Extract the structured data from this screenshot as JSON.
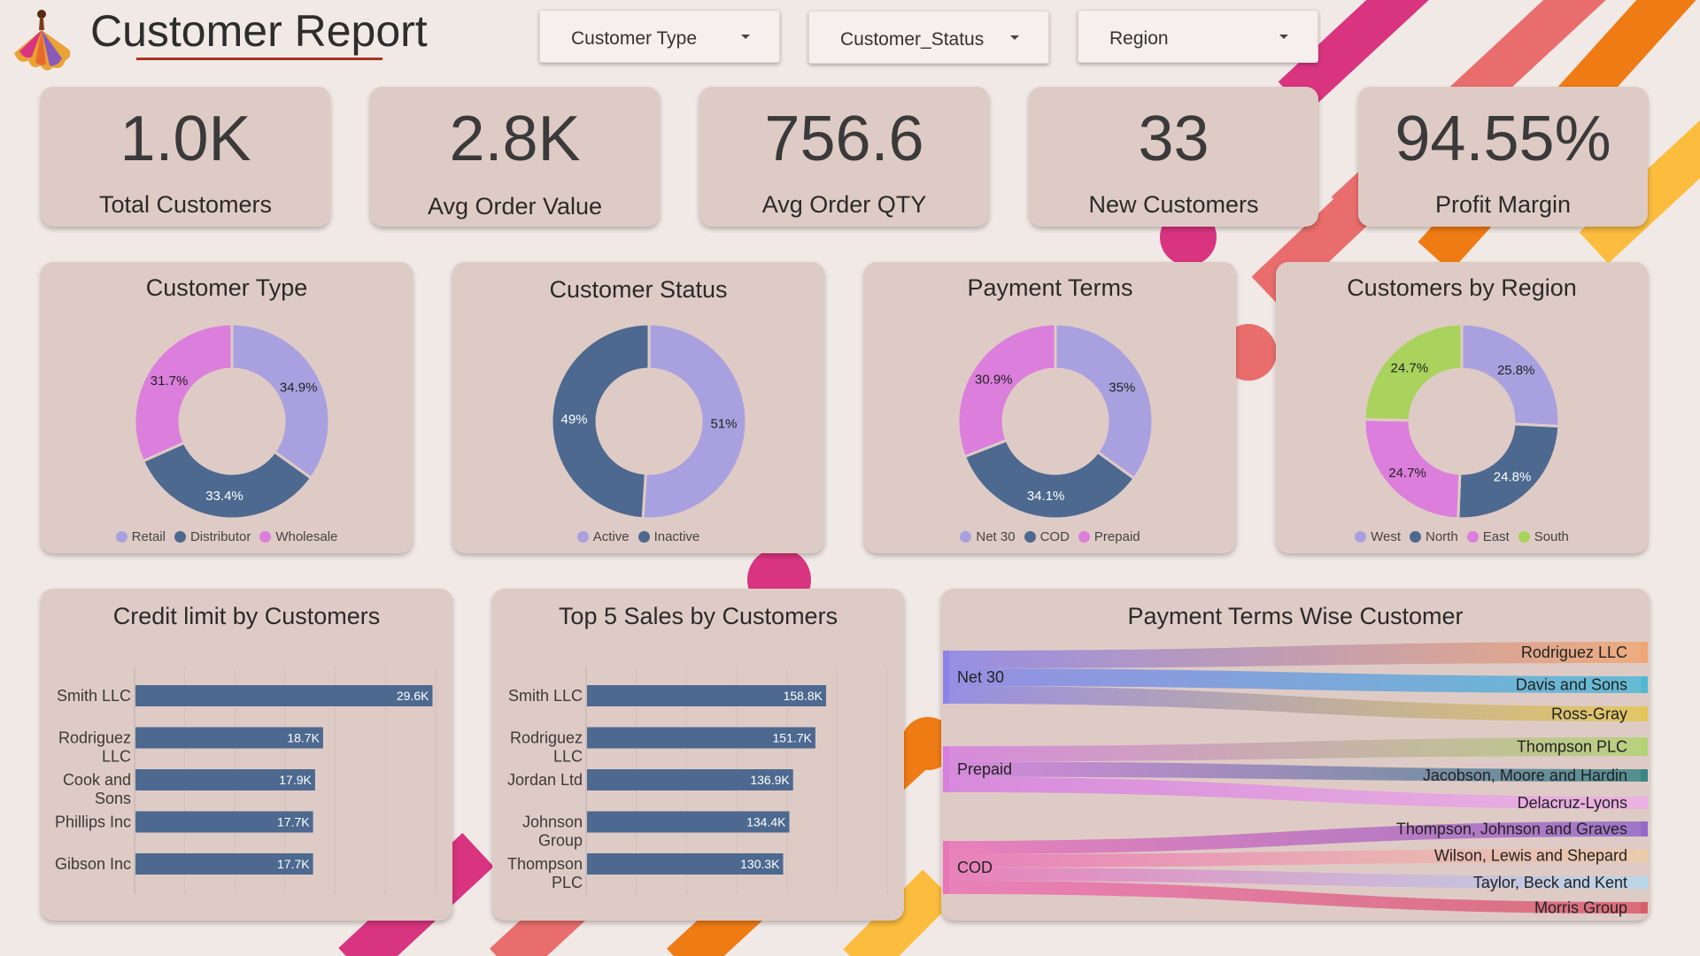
{
  "header": {
    "title": "Customer Report"
  },
  "slicers": [
    {
      "label": "Customer Type"
    },
    {
      "label": "Customer_Status"
    },
    {
      "label": "Region"
    }
  ],
  "kpis": [
    {
      "value": "1.0K",
      "label": "Total Customers"
    },
    {
      "value": "2.8K",
      "label": "Avg Order Value"
    },
    {
      "value": "756.6",
      "label": "Avg Order QTY"
    },
    {
      "value": "33",
      "label": "New Customers"
    },
    {
      "value": "94.55%",
      "label": "Profit Margin"
    }
  ],
  "colors": {
    "lavender": "#a9a1df",
    "slate": "#4d6990",
    "orchid": "#db7edc",
    "lime": "#a9d35c",
    "bar": "#4d6990",
    "card": "#dfcbc5",
    "background": "#f1e9e6"
  },
  "chart_data": [
    {
      "type": "pie",
      "title": "Customer Type",
      "categories": [
        "Retail",
        "Distributor",
        "Wholesale"
      ],
      "values": [
        34.9,
        33.4,
        31.7
      ],
      "labels": [
        "34.9%",
        "33.4%",
        "31.7%"
      ],
      "colors": [
        "#a9a1df",
        "#4d6990",
        "#db7edc"
      ],
      "legend": "bottom"
    },
    {
      "type": "pie",
      "title": "Customer Status",
      "categories": [
        "Active",
        "Inactive"
      ],
      "values": [
        51,
        49
      ],
      "labels": [
        "51%",
        "49%"
      ],
      "colors": [
        "#a9a1df",
        "#4d6990"
      ],
      "legend": "bottom"
    },
    {
      "type": "pie",
      "title": "Payment Terms",
      "categories": [
        "Net 30",
        "COD",
        "Prepaid"
      ],
      "values": [
        35,
        34.1,
        30.9
      ],
      "labels": [
        "35%",
        "34.1%",
        "30.9%"
      ],
      "colors": [
        "#a9a1df",
        "#4d6990",
        "#db7edc"
      ],
      "legend": "bottom"
    },
    {
      "type": "pie",
      "title": "Customers by Region",
      "categories": [
        "West",
        "North",
        "East",
        "South"
      ],
      "values": [
        25.8,
        24.8,
        24.7,
        24.7
      ],
      "labels": [
        "25.8%",
        "24.8%",
        "24.7%",
        "24.7%"
      ],
      "colors": [
        "#a9a1df",
        "#4d6990",
        "#db7edc",
        "#a9d35c"
      ],
      "legend": "bottom"
    },
    {
      "type": "bar",
      "orientation": "horizontal",
      "title": "Credit limit by Customers",
      "categories": [
        [
          "Smith LLC"
        ],
        [
          "Rodriguez",
          "LLC"
        ],
        [
          "Cook and",
          "Sons"
        ],
        [
          "Phillips Inc"
        ],
        [
          "Gibson Inc"
        ]
      ],
      "values": [
        29.6,
        18.7,
        17.9,
        17.7,
        17.7
      ],
      "labels": [
        "29.6K",
        "18.7K",
        "17.9K",
        "17.7K",
        "17.7K"
      ],
      "xlim": [
        0,
        30
      ],
      "grid": true
    },
    {
      "type": "bar",
      "orientation": "horizontal",
      "title": "Top 5 Sales by Customers",
      "categories": [
        [
          "Smith LLC"
        ],
        [
          "Rodriguez",
          "LLC"
        ],
        [
          "Jordan Ltd"
        ],
        [
          "Johnson",
          "Group"
        ],
        [
          "Thompson",
          "PLC"
        ]
      ],
      "values": [
        158.8,
        151.7,
        136.9,
        134.4,
        130.3
      ],
      "labels": [
        "158.8K",
        "151.7K",
        "136.9K",
        "134.4K",
        "130.3K"
      ],
      "xlim": [
        0,
        200
      ],
      "grid": true
    },
    {
      "type": "sankey",
      "title": "Payment Terms Wise Customer",
      "sources": [
        {
          "name": "Net 30",
          "color": "#8a84e8"
        },
        {
          "name": "Prepaid",
          "color": "#d67fe0"
        },
        {
          "name": "COD",
          "color": "#ea74b8"
        }
      ],
      "targets": [
        {
          "name": "Rodriguez LLC",
          "color": "#f0a672",
          "source": "Net 30"
        },
        {
          "name": "Davis and Sons",
          "color": "#4fb9d4",
          "source": "Net 30"
        },
        {
          "name": "Ross-Gray",
          "color": "#e3c655",
          "source": "Net 30"
        },
        {
          "name": "Thompson PLC",
          "color": "#b2d274",
          "source": "Prepaid"
        },
        {
          "name": "Jacobson, Moore and Hardin",
          "color": "#3a8586",
          "source": "Prepaid"
        },
        {
          "name": "Delacruz-Lyons",
          "color": "#ecaee6",
          "source": "Prepaid"
        },
        {
          "name": "Thompson, Johnson and Graves",
          "color": "#9468c8",
          "source": "COD"
        },
        {
          "name": "Wilson, Lewis and Shepard",
          "color": "#ecccaa",
          "source": "COD"
        },
        {
          "name": "Taylor, Beck and Kent",
          "color": "#b6d8ee",
          "source": "COD"
        },
        {
          "name": "Morris Group",
          "color": "#d85e6c",
          "source": "COD"
        }
      ]
    }
  ]
}
